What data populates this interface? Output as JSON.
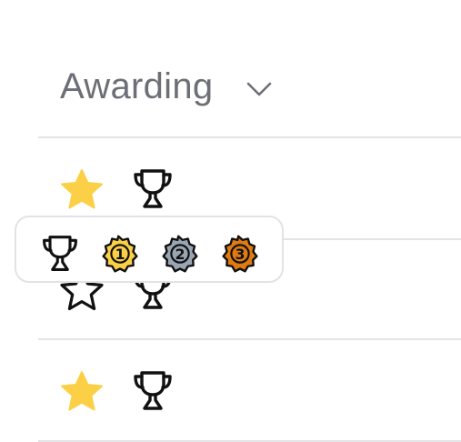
{
  "header": {
    "title": "Awarding",
    "dropdown_icon": "chevron-down-icon"
  },
  "rows": [
    {
      "star": "filled",
      "star_icon": "star-filled-icon",
      "trophy_icon": "trophy-icon"
    },
    {
      "star": "outline",
      "star_icon": "star-outline-icon",
      "trophy_icon": "trophy-icon"
    },
    {
      "star": "filled",
      "star_icon": "star-filled-icon",
      "trophy_icon": "trophy-icon"
    }
  ],
  "award_picker": {
    "options": [
      {
        "name": "trophy",
        "icon": "trophy-icon"
      },
      {
        "name": "first-place",
        "label": "1",
        "icon": "medal-gold-icon",
        "color": "#fbd046"
      },
      {
        "name": "second-place",
        "label": "2",
        "icon": "medal-silver-icon",
        "color": "#9aa5b4"
      },
      {
        "name": "third-place",
        "label": "3",
        "icon": "medal-bronze-icon",
        "color": "#e07b12"
      }
    ]
  },
  "colors": {
    "star_fill": "#fbd046",
    "title": "#6e6f76",
    "divider": "#e4e4e6",
    "icon_stroke": "#111111"
  }
}
